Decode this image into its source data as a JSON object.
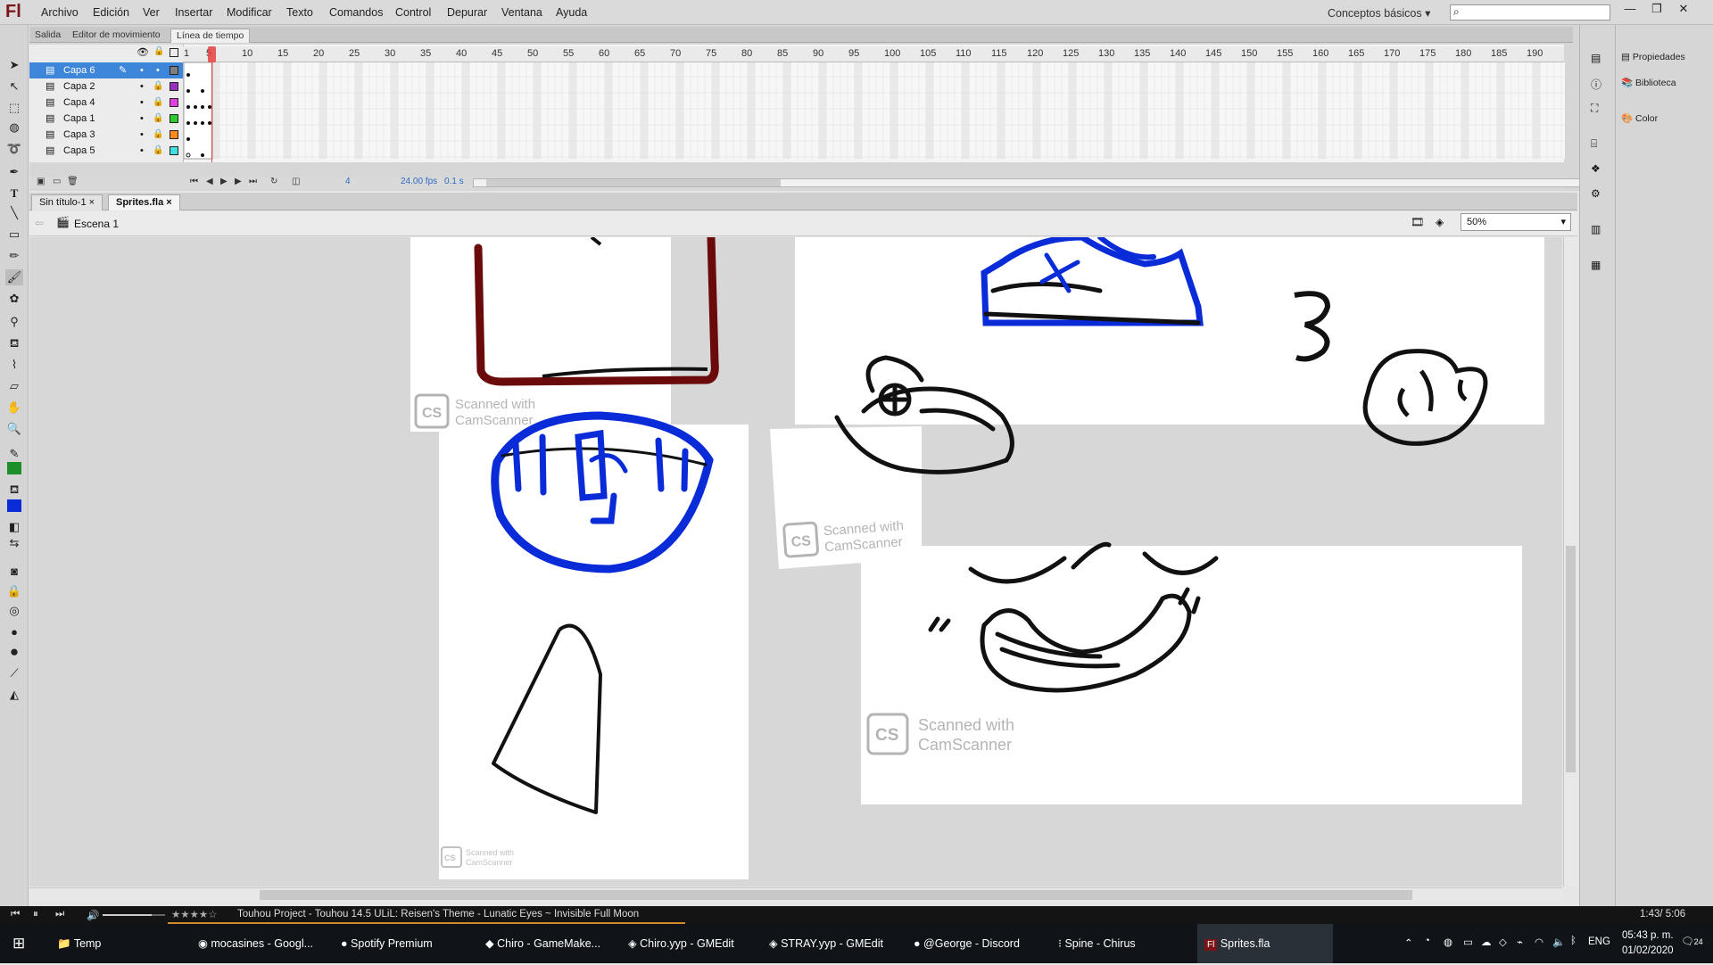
{
  "app": {
    "logo": "Fl"
  },
  "menu": [
    "Archivo",
    "Edición",
    "Ver",
    "Insertar",
    "Modificar",
    "Texto",
    "Comandos",
    "Control",
    "Depurar",
    "Ventana",
    "Ayuda"
  ],
  "workspace": {
    "label": "Conceptos básicos"
  },
  "panel_tabs": [
    "Salida",
    "Editor de movimiento",
    "Línea de tiempo"
  ],
  "layers": [
    {
      "name": "Capa 6",
      "color": "#7f7f7f"
    },
    {
      "name": "Capa 2",
      "color": "#9b30c0"
    },
    {
      "name": "Capa 4",
      "color": "#e040e0"
    },
    {
      "name": "Capa 1",
      "color": "#2ecc2e"
    },
    {
      "name": "Capa 3",
      "color": "#ff8c1a"
    },
    {
      "name": "Capa 5",
      "color": "#40e0e0"
    }
  ],
  "ruler": [
    "1",
    "5",
    "10",
    "15",
    "20",
    "25",
    "30",
    "35",
    "40",
    "45",
    "50",
    "55",
    "60",
    "65",
    "70",
    "75",
    "80",
    "85",
    "90",
    "95",
    "100",
    "105",
    "110",
    "115",
    "120",
    "125",
    "130",
    "135",
    "140",
    "145",
    "150",
    "155",
    "160",
    "165",
    "170",
    "175",
    "180",
    "185",
    "190"
  ],
  "timeline_status": {
    "frame": "4",
    "fps": "24.00 fps",
    "time": "0.1 s"
  },
  "doc_tabs": [
    "Sin título-1",
    "Sprites.fla"
  ],
  "scene": "Escena 1",
  "zoom": "50%",
  "right_panels": [
    "Propiedades",
    "Biblioteca",
    "Color"
  ],
  "watermark": {
    "line1": "Scanned with",
    "line2": "CamScanner",
    "badge": "CS"
  },
  "player": {
    "now_playing": "Touhou Project - Touhou 14.5 ULiL: Reisen's Theme - Lunatic Eyes ~ Invisible Full Moon",
    "time": "1:43/ 5:06",
    "rating": 4
  },
  "taskbar": {
    "items": [
      "Temp",
      "mocasines - Googl...",
      "Spotify Premium",
      "Chiro - GameMake...",
      "Chiro.yyp - GMEdit",
      "STRAY.yyp - GMEdit",
      "@George - Discord",
      "Spine - Chirus",
      "Sprites.fla"
    ],
    "lang": "ENG",
    "time": "05:43 p. m.",
    "date": "01/02/2020",
    "notifications": "24"
  },
  "colors": {
    "accent": "#3d86d9",
    "stroke": "#1a8f2a",
    "fill": "#0a2bd8",
    "playhead": "#e84040"
  }
}
